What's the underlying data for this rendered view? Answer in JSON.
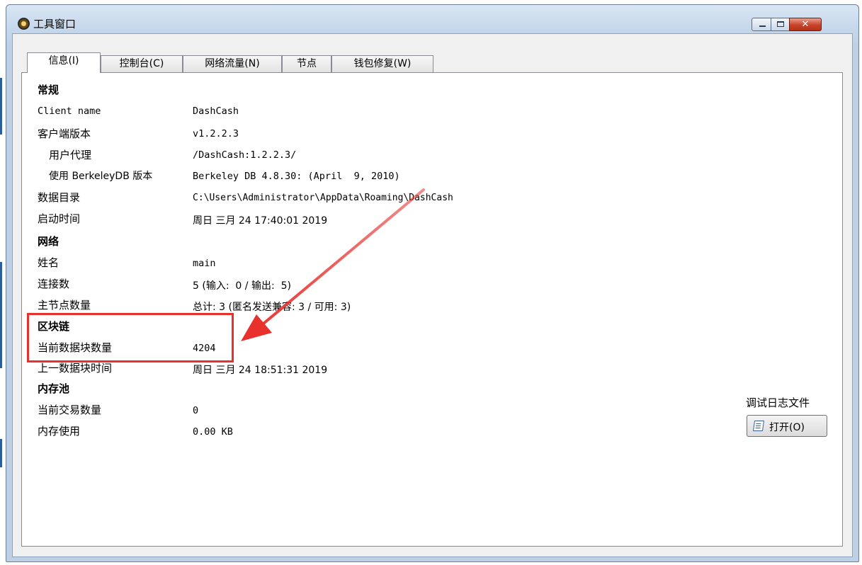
{
  "window": {
    "title": "工具窗口",
    "close_glyph": "✕"
  },
  "tabs": [
    {
      "label": "信息(I)"
    },
    {
      "label": "控制台(C)"
    },
    {
      "label": "网络流量(N)"
    },
    {
      "label": "节点"
    },
    {
      "label": "钱包修复(W)"
    }
  ],
  "info": {
    "general": {
      "header": "常规",
      "client_name_label": "Client name",
      "client_name_value": "DashCash",
      "client_version_label": "客户端版本",
      "client_version_value": "v1.2.2.3",
      "user_agent_label": "用户代理",
      "user_agent_value": "/DashCash:1.2.2.3/",
      "berkeleydb_label": "使用 BerkeleyDB 版本",
      "berkeleydb_value": "Berkeley DB 4.8.30: (April  9, 2010)",
      "datadir_label": "数据目录",
      "datadir_value": "C:\\Users\\Administrator\\AppData\\Roaming\\DashCash",
      "startup_label": "启动时间",
      "startup_value": "周日 三月 24 17:40:01 2019"
    },
    "network": {
      "header": "网络",
      "name_label": "姓名",
      "name_value": "main",
      "connections_label": "连接数",
      "connections_value": "5 (输入:  0 / 输出:  5)",
      "masternodes_label": "主节点数量",
      "masternodes_value": "总计: 3 (匿名发送兼容: 3 / 可用: 3)"
    },
    "blockchain": {
      "header": "区块链",
      "blocks_label": "当前数据块数量",
      "blocks_value": "4204",
      "last_block_label": "上一数据块时间",
      "last_block_value": "周日 三月 24 18:51:31 2019"
    },
    "mempool": {
      "header": "内存池",
      "tx_label": "当前交易数量",
      "tx_value": "0",
      "usage_label": "内存使用",
      "usage_value": "0.00 KB"
    }
  },
  "debug_log": {
    "label": "调试日志文件",
    "open_button": "打开(O)"
  },
  "annotation": {
    "color": "#e8302c"
  }
}
